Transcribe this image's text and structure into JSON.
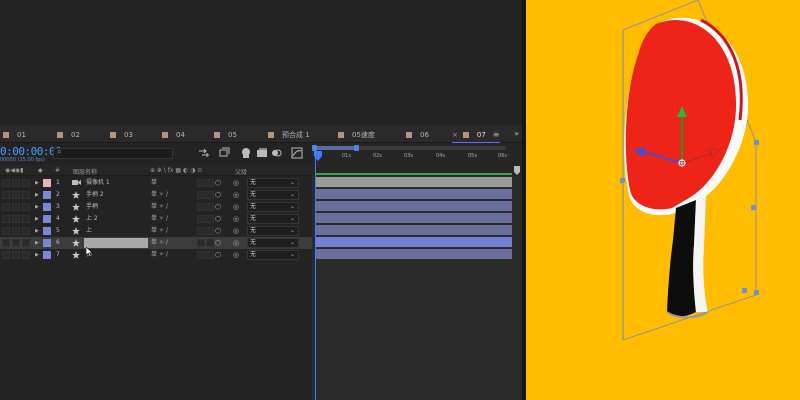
{
  "tabs": [
    {
      "label": "01"
    },
    {
      "label": "02"
    },
    {
      "label": "03"
    },
    {
      "label": "04"
    },
    {
      "label": "05"
    },
    {
      "label": "预合成 1"
    },
    {
      "label": "05速度"
    },
    {
      "label": "06"
    },
    {
      "label": "07",
      "active": true
    }
  ],
  "tab_close": "×",
  "tab_menu": "≡",
  "tab_more": "»",
  "timecode": "0:00:00:00",
  "fps": "00000 (25.00 fps)",
  "search": {
    "icon": "⌕",
    "placeholder": ""
  },
  "ruler": {
    "ticks": [
      "0s",
      "01s",
      "02s",
      "03s",
      "04s",
      "05s",
      "06s"
    ]
  },
  "columns": {
    "hash": "#",
    "layer_name": "图层名称",
    "switches": "⊕ ✻ \\ fx ▦ ◐ ◑ ⊙",
    "parent": "父级"
  },
  "layers": [
    {
      "num": "1",
      "icon": "camera-icon",
      "name": "摄像机 1",
      "switch": "单",
      "parent": "无",
      "color": "#e9b4b6",
      "bar": "#9b9b9b",
      "selected": false
    },
    {
      "num": "2",
      "icon": "star-icon",
      "name": "手柄 2",
      "switch": "单 ✧ /",
      "parent": "无",
      "color": "#7a86d8",
      "bar": "#6a6f9c",
      "selected": false
    },
    {
      "num": "3",
      "icon": "star-icon",
      "name": "手柄",
      "switch": "单 ✧ /",
      "parent": "无",
      "color": "#7a86d8",
      "bar": "#6a6f9c",
      "selected": false
    },
    {
      "num": "4",
      "icon": "star-icon",
      "name": "上 2",
      "switch": "单 ✧ /",
      "parent": "无",
      "color": "#7a86d8",
      "bar": "#6a6f9c",
      "selected": false
    },
    {
      "num": "5",
      "icon": "star-icon",
      "name": "上",
      "switch": "单 ✧ /",
      "parent": "无",
      "color": "#7a86d8",
      "bar": "#6a6f9c",
      "selected": false
    },
    {
      "num": "6",
      "icon": "star-icon",
      "name": "",
      "switch": "单 ✧ /",
      "parent": "无",
      "color": "#7a86d8",
      "bar": "#7380d6",
      "selected": true
    },
    {
      "num": "7",
      "icon": "star-icon",
      "name": "拍",
      "switch": "单 ✧ /",
      "parent": "无",
      "color": "#7a86d8",
      "bar": "#6a6f9c",
      "selected": false
    }
  ],
  "colors": {
    "timecode": "#4d9cff",
    "viewer_bg": "#ffbc00",
    "paddle_red": "#ef2418",
    "accent": "#5a6eff"
  }
}
